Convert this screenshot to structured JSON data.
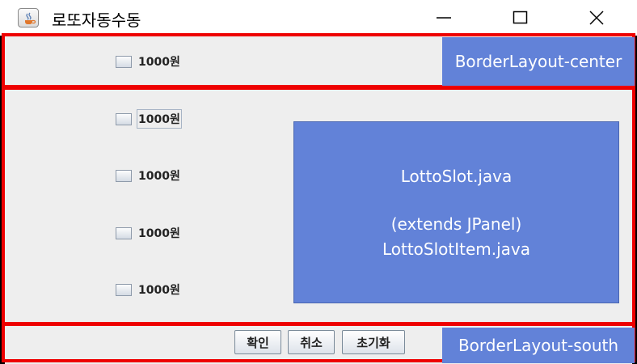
{
  "window": {
    "title": "로또자동수동"
  },
  "center_panel": {
    "checkbox": {
      "label": "1000원",
      "checked": false
    },
    "annotation": "BorderLayout-center"
  },
  "slot_panel": {
    "checkboxes": [
      {
        "label": "1000원",
        "checked": false,
        "focused": true
      },
      {
        "label": "1000원",
        "checked": false
      },
      {
        "label": "1000원",
        "checked": false
      },
      {
        "label": "1000원",
        "checked": false
      }
    ],
    "annotation": {
      "line1": "LottoSlot.java",
      "line2": "(extends JPanel)",
      "line3": "LottoSlotItem.java"
    }
  },
  "south_panel": {
    "buttons": {
      "confirm": "확인",
      "cancel": "취소",
      "reset": "초기화"
    },
    "annotation": "BorderLayout-south"
  },
  "colors": {
    "annotation_fill": "#6282d8",
    "highlight_border": "#ee0000",
    "panel_background": "#eeeeee"
  },
  "icons": [
    "java-app-icon",
    "minimize-icon",
    "maximize-icon",
    "close-icon"
  ]
}
